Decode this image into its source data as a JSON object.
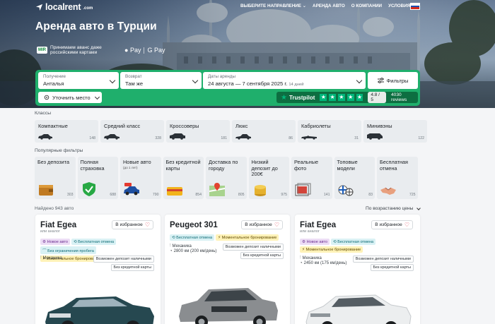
{
  "header": {
    "logo_text": "localrent",
    "logo_suffix": ".com",
    "nav": [
      "ВЫБЕРИТЕ НАПРАВЛЕНИЕ",
      "АРЕНДА АВТО",
      "О КОМПАНИИ",
      "УСЛОВИЯ"
    ],
    "flag": "ru"
  },
  "hero": {
    "title": "Аренда авто в Турции",
    "mir_badge": "MIR",
    "mir_text": "Принимаем аванс даже российскими картами",
    "apple_pay": "Pay",
    "google_pay": "G Pay"
  },
  "search": {
    "pickup_label": "Получение",
    "pickup_value": "Анталья",
    "return_label": "Возврат",
    "return_value": "Там же",
    "dates_label": "Даты аренды",
    "dates_value": "24 августа — 7 сентября 2025 г.",
    "dates_days": "14 дней",
    "filters_label": "Фильтры",
    "location_label": "Уточнить место"
  },
  "trustpilot": {
    "name": "Trustpilot",
    "score": "4.8 / 5",
    "reviews": "4030 reviews"
  },
  "classes": {
    "title": "Классы",
    "items": [
      {
        "name": "Компактные",
        "count": "148"
      },
      {
        "name": "Средний класс",
        "count": "328"
      },
      {
        "name": "Кроссоверы",
        "count": "181"
      },
      {
        "name": "Люкс",
        "count": "86"
      },
      {
        "name": "Кабриолеты",
        "count": "31"
      },
      {
        "name": "Минивэны",
        "count": "122"
      }
    ]
  },
  "popular": {
    "title": "Популярные фильтры",
    "items": [
      {
        "name": "Без депозита",
        "sub": "",
        "count": "303",
        "icon": "wallet-icon"
      },
      {
        "name": "Полная страховка",
        "sub": "",
        "count": "688",
        "icon": "shield-check-icon"
      },
      {
        "name": "Новые авто",
        "sub": "(до 1 лет)",
        "count": "790",
        "icon": "new-car-icon"
      },
      {
        "name": "Без кредитной карты",
        "sub": "",
        "count": "854",
        "icon": "credit-card-icon"
      },
      {
        "name": "Доставка по городу",
        "sub": "",
        "count": "805",
        "icon": "map-pin-icon"
      },
      {
        "name": "Низкий депозит до 200€",
        "sub": "",
        "count": "975",
        "icon": "coins-icon"
      },
      {
        "name": "Реальные фото",
        "sub": "",
        "count": "141",
        "icon": "photo-icon"
      },
      {
        "name": "Топовые модели",
        "sub": "",
        "count": "83",
        "icon": "brand-logos-icon"
      },
      {
        "name": "Бесплатная отмена",
        "sub": "",
        "count": "725",
        "icon": "handshake-icon"
      }
    ]
  },
  "results": {
    "found": "Найдено 943 авто",
    "sort": "По возрастанию цены"
  },
  "cars": [
    {
      "model": "Fiat Egea",
      "similar": "или аналог",
      "fav": "В избранное",
      "tags": [
        {
          "text": "Новое авто",
          "kind": "new"
        },
        {
          "text": "Бесплатная отмена",
          "kind": "free"
        },
        {
          "text": "Без ограничения пробега",
          "kind": "nolim"
        },
        {
          "text": "Моментальное бронирование",
          "kind": "inst"
        }
      ],
      "transmission": "Механика",
      "mileage": "",
      "deposit": [
        "Возможен депозит наличными",
        "Без кредитной карты"
      ],
      "color": "#264850"
    },
    {
      "model": "Peugeot 301",
      "similar": "",
      "fav": "В избранное",
      "tags": [
        {
          "text": "Бесплатная отмена",
          "kind": "free"
        },
        {
          "text": "Моментальное бронирование",
          "kind": "inst"
        }
      ],
      "transmission": "Механика",
      "mileage": "2800 км (200 км/день)",
      "deposit": [
        "Возможен депозит наличными",
        "Без кредитной карты"
      ],
      "color": "#8a8d90"
    },
    {
      "model": "Fiat Egea",
      "similar": "или аналог",
      "fav": "В избранное",
      "tags": [
        {
          "text": "Новое авто",
          "kind": "new"
        },
        {
          "text": "Бесплатная отмена",
          "kind": "free"
        },
        {
          "text": "Моментальное бронирование",
          "kind": "inst"
        }
      ],
      "transmission": "Механика",
      "mileage": "2450 км (175 км/день)",
      "deposit": [
        "Возможен депозит наличными",
        "Без кредитной карты"
      ],
      "color": "#f2f3f4"
    }
  ]
}
